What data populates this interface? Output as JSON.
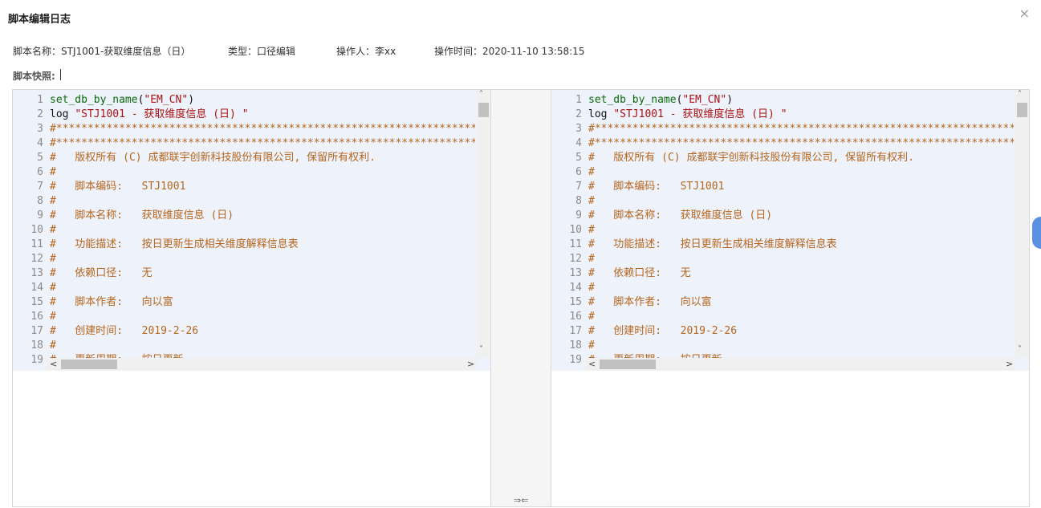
{
  "dialog": {
    "title": "脚本编辑日志",
    "close_icon": "×"
  },
  "meta": {
    "script_name": "脚本名称：STJ1001-获取维度信息（日）",
    "type": "类型：口径编辑",
    "operator": "操作人：李xx",
    "op_time": "操作时间：2020-11-10 13:58:15",
    "snapshot_label": "脚本快照:"
  },
  "editor_lines": [
    {
      "n": "1",
      "segs": [
        {
          "c": "fn",
          "t": "set_db_by_name"
        },
        {
          "c": "plain",
          "t": "("
        },
        {
          "c": "str",
          "t": "\"EM_CN\""
        },
        {
          "c": "plain",
          "t": ")"
        }
      ]
    },
    {
      "n": "2",
      "segs": [
        {
          "c": "plain",
          "t": "log "
        },
        {
          "c": "str",
          "t": "\"STJ1001 - 获取维度信息 (日) \""
        }
      ]
    },
    {
      "n": "3",
      "segs": [
        {
          "c": "cmt",
          "t": "#***************************************************************************"
        }
      ]
    },
    {
      "n": "4",
      "segs": [
        {
          "c": "cmt",
          "t": "#***************************************************************************"
        }
      ]
    },
    {
      "n": "5",
      "segs": [
        {
          "c": "cmt",
          "t": "#   版权所有 (C) 成都联宇创新科技股份有限公司, 保留所有权利."
        }
      ]
    },
    {
      "n": "6",
      "segs": [
        {
          "c": "cmt",
          "t": "#"
        }
      ]
    },
    {
      "n": "7",
      "segs": [
        {
          "c": "cmt",
          "t": "#   脚本编码:   STJ1001"
        }
      ]
    },
    {
      "n": "8",
      "segs": [
        {
          "c": "cmt",
          "t": "#"
        }
      ]
    },
    {
      "n": "9",
      "segs": [
        {
          "c": "cmt",
          "t": "#   脚本名称:   获取维度信息 (日)"
        }
      ]
    },
    {
      "n": "10",
      "segs": [
        {
          "c": "cmt",
          "t": "#"
        }
      ]
    },
    {
      "n": "11",
      "segs": [
        {
          "c": "cmt",
          "t": "#   功能描述:   按日更新生成相关维度解释信息表"
        }
      ]
    },
    {
      "n": "12",
      "segs": [
        {
          "c": "cmt",
          "t": "#"
        }
      ]
    },
    {
      "n": "13",
      "segs": [
        {
          "c": "cmt",
          "t": "#   依赖口径:   无"
        }
      ]
    },
    {
      "n": "14",
      "segs": [
        {
          "c": "cmt",
          "t": "#"
        }
      ]
    },
    {
      "n": "15",
      "segs": [
        {
          "c": "cmt",
          "t": "#   脚本作者:   向以富"
        }
      ]
    },
    {
      "n": "16",
      "segs": [
        {
          "c": "cmt",
          "t": "#"
        }
      ]
    },
    {
      "n": "17",
      "segs": [
        {
          "c": "cmt",
          "t": "#   创建时间:   2019-2-26"
        }
      ]
    },
    {
      "n": "18",
      "segs": [
        {
          "c": "cmt",
          "t": "#"
        }
      ]
    },
    {
      "n": "19",
      "segs": [
        {
          "c": "cmt",
          "t": "#   更新周期:   按日更新"
        }
      ]
    }
  ],
  "scroll": {
    "up_icon": "˄",
    "down_icon": "˅",
    "left_icon": "<",
    "right_icon": ">"
  },
  "merge_arrows": "⇒⇐"
}
